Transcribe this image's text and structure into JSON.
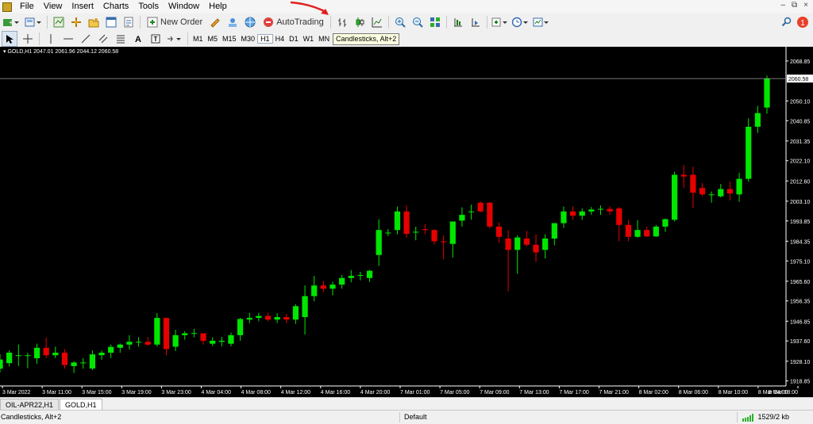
{
  "menu": [
    "File",
    "View",
    "Insert",
    "Charts",
    "Tools",
    "Window",
    "Help"
  ],
  "toolbar": {
    "new_order": "New Order",
    "auto_trading": "AutoTrading",
    "timeframes": [
      "M1",
      "M5",
      "M15",
      "M30",
      "H1",
      "H4",
      "D1",
      "W1",
      "MN"
    ],
    "active_timeframe": "H1",
    "notification_count": "1"
  },
  "tooltip": "Candlesticks, Alt+2",
  "chart": {
    "symbol": "GOLD,H1",
    "ohlc": "2047.01 2061.96 2044.12 2060.58",
    "current_price": "2060.58",
    "price_axis": [
      "2068.85",
      "2060.58",
      "2050.10",
      "2040.85",
      "2031.35",
      "2022.10",
      "2012.60",
      "2003.10",
      "1993.85",
      "1984.35",
      "1975.10",
      "1965.60",
      "1956.35",
      "1946.85",
      "1937.60",
      "1928.10",
      "1918.85"
    ],
    "time_axis": [
      "3 Mar 2022",
      "3 Mar 11:00",
      "3 Mar 15:00",
      "3 Mar 19:00",
      "3 Mar 23:00",
      "4 Mar 04:00",
      "4 Mar 08:00",
      "4 Mar 12:00",
      "4 Mar 16:00",
      "4 Mar 20:00",
      "7 Mar 01:00",
      "7 Mar 05:00",
      "7 Mar 09:00",
      "7 Mar 13:00",
      "7 Mar 17:00",
      "7 Mar 21:00",
      "8 Mar 02:00",
      "8 Mar 06:00",
      "8 Mar 10:00",
      "8 Mar 14:00",
      "8 Mar 18:00"
    ],
    "colors": {
      "bull": "#00e600",
      "bear": "#e60000",
      "background": "#000000",
      "text": "#ffffff"
    }
  },
  "chart_data": {
    "type": "candlestick",
    "ylim": [
      1916.5,
      2075.5
    ],
    "candles": [
      {
        "o": 1924.6,
        "h": 1931.4,
        "l": 1922.8,
        "c": 1928.9
      },
      {
        "o": 1927.2,
        "h": 1933.2,
        "l": 1925.6,
        "c": 1932.1
      },
      {
        "o": 1930.9,
        "h": 1935.9,
        "l": 1925.8,
        "c": 1930.9
      },
      {
        "o": 1930.9,
        "h": 1932.0,
        "l": 1924.8,
        "c": 1930.9
      },
      {
        "o": 1929.5,
        "h": 1936.3,
        "l": 1926.9,
        "c": 1934.4
      },
      {
        "o": 1934.4,
        "h": 1939.2,
        "l": 1929.6,
        "c": 1930.9
      },
      {
        "o": 1930.9,
        "h": 1934.9,
        "l": 1929.6,
        "c": 1932.1
      },
      {
        "o": 1932.1,
        "h": 1933.8,
        "l": 1924.6,
        "c": 1926.3
      },
      {
        "o": 1925.8,
        "h": 1928.1,
        "l": 1922.6,
        "c": 1927.5
      },
      {
        "o": 1927.5,
        "h": 1929.6,
        "l": 1924.6,
        "c": 1927.5
      },
      {
        "o": 1924.7,
        "h": 1933.2,
        "l": 1923.9,
        "c": 1931.3
      },
      {
        "o": 1930.9,
        "h": 1933.1,
        "l": 1928.8,
        "c": 1932.1
      },
      {
        "o": 1932.1,
        "h": 1935.9,
        "l": 1929.6,
        "c": 1934.8
      },
      {
        "o": 1934.4,
        "h": 1936.4,
        "l": 1932.1,
        "c": 1935.9
      },
      {
        "o": 1935.9,
        "h": 1940.3,
        "l": 1933.6,
        "c": 1937.2
      },
      {
        "o": 1937.2,
        "h": 1939.4,
        "l": 1934.9,
        "c": 1937.2
      },
      {
        "o": 1937.2,
        "h": 1939.4,
        "l": 1935.3,
        "c": 1935.9
      },
      {
        "o": 1935.9,
        "h": 1950.6,
        "l": 1934.9,
        "c": 1948.4
      },
      {
        "o": 1948.4,
        "h": 1948.5,
        "l": 1930.9,
        "c": 1933.8
      },
      {
        "o": 1934.9,
        "h": 1942.8,
        "l": 1932.9,
        "c": 1940.3
      },
      {
        "o": 1940.3,
        "h": 1942.2,
        "l": 1938.2,
        "c": 1941.2
      },
      {
        "o": 1941.3,
        "h": 1943.3,
        "l": 1939.3,
        "c": 1941.3
      },
      {
        "o": 1941.2,
        "h": 1941.2,
        "l": 1935.9,
        "c": 1937.7
      },
      {
        "o": 1936.3,
        "h": 1939.3,
        "l": 1935.2,
        "c": 1937.7
      },
      {
        "o": 1937.2,
        "h": 1939.5,
        "l": 1935.1,
        "c": 1937.7
      },
      {
        "o": 1936.3,
        "h": 1941.5,
        "l": 1935.1,
        "c": 1940.3
      },
      {
        "o": 1940.3,
        "h": 1948.4,
        "l": 1937.7,
        "c": 1947.9
      },
      {
        "o": 1947.6,
        "h": 1950.8,
        "l": 1945.9,
        "c": 1948.4
      },
      {
        "o": 1948.4,
        "h": 1950.8,
        "l": 1946.8,
        "c": 1949.3
      },
      {
        "o": 1949.3,
        "h": 1950.9,
        "l": 1946.8,
        "c": 1947.6
      },
      {
        "o": 1947.6,
        "h": 1950.6,
        "l": 1946.0,
        "c": 1948.8
      },
      {
        "o": 1948.8,
        "h": 1950.3,
        "l": 1946.0,
        "c": 1947.6
      },
      {
        "o": 1947.6,
        "h": 1954.8,
        "l": 1945.6,
        "c": 1953.9
      },
      {
        "o": 1948.8,
        "h": 1963.6,
        "l": 1940.6,
        "c": 1958.6
      },
      {
        "o": 1958.6,
        "h": 1968.1,
        "l": 1956.2,
        "c": 1963.6
      },
      {
        "o": 1963.6,
        "h": 1965.7,
        "l": 1960.5,
        "c": 1962.1
      },
      {
        "o": 1962.1,
        "h": 1965.3,
        "l": 1958.9,
        "c": 1964.0
      },
      {
        "o": 1964.0,
        "h": 1968.5,
        "l": 1962.1,
        "c": 1967.1
      },
      {
        "o": 1967.1,
        "h": 1970.8,
        "l": 1965.1,
        "c": 1968.1
      },
      {
        "o": 1968.1,
        "h": 1970.0,
        "l": 1966.0,
        "c": 1968.5
      },
      {
        "o": 1967.1,
        "h": 1970.9,
        "l": 1965.3,
        "c": 1970.5
      },
      {
        "o": 1977.9,
        "h": 1994.7,
        "l": 1972.8,
        "c": 1989.6
      },
      {
        "o": 1988.4,
        "h": 1990.0,
        "l": 1986.8,
        "c": 1988.4
      },
      {
        "o": 1989.6,
        "h": 2000.6,
        "l": 1987.6,
        "c": 1998.3
      },
      {
        "o": 1998.3,
        "h": 2001.1,
        "l": 1986.0,
        "c": 1987.8
      },
      {
        "o": 1988.4,
        "h": 1991.2,
        "l": 1984.8,
        "c": 1988.8
      },
      {
        "o": 1990.0,
        "h": 1992.4,
        "l": 1987.6,
        "c": 1989.6
      },
      {
        "o": 1989.6,
        "h": 1990.0,
        "l": 1982.8,
        "c": 1984.3
      },
      {
        "o": 1984.3,
        "h": 1987.1,
        "l": 1975.9,
        "c": 1983.9
      },
      {
        "o": 1983.1,
        "h": 1993.2,
        "l": 1976.7,
        "c": 1993.6
      },
      {
        "o": 1994.0,
        "h": 2000.2,
        "l": 1991.2,
        "c": 1996.7
      },
      {
        "o": 1998.3,
        "h": 2001.5,
        "l": 1994.4,
        "c": 1998.3
      },
      {
        "o": 2002.4,
        "h": 2003.0,
        "l": 1997.9,
        "c": 1998.3
      },
      {
        "o": 2002.4,
        "h": 2002.8,
        "l": 1990.4,
        "c": 1991.2
      },
      {
        "o": 1991.2,
        "h": 1993.2,
        "l": 1983.6,
        "c": 1986.4
      },
      {
        "o": 1985.6,
        "h": 1989.6,
        "l": 1960.9,
        "c": 1980.3
      },
      {
        "o": 1980.3,
        "h": 1987.1,
        "l": 1969.1,
        "c": 1986.1
      },
      {
        "o": 1985.6,
        "h": 1989.2,
        "l": 1981.8,
        "c": 1982.7
      },
      {
        "o": 1982.7,
        "h": 1987.6,
        "l": 1974.6,
        "c": 1979.1
      },
      {
        "o": 1980.3,
        "h": 1987.6,
        "l": 1976.3,
        "c": 1985.6
      },
      {
        "o": 1985.6,
        "h": 1992.8,
        "l": 1982.4,
        "c": 1992.8
      },
      {
        "o": 1992.8,
        "h": 2000.6,
        "l": 1990.6,
        "c": 1998.3
      },
      {
        "o": 1998.3,
        "h": 2000.7,
        "l": 1994.4,
        "c": 1996.3
      },
      {
        "o": 1996.3,
        "h": 1999.8,
        "l": 1994.4,
        "c": 1998.3
      },
      {
        "o": 1998.3,
        "h": 2000.4,
        "l": 1996.7,
        "c": 1999.2
      },
      {
        "o": 1999.2,
        "h": 2001.1,
        "l": 1996.7,
        "c": 1999.5
      },
      {
        "o": 1999.5,
        "h": 2000.7,
        "l": 1996.7,
        "c": 1998.3
      },
      {
        "o": 1999.7,
        "h": 2000.4,
        "l": 1984.3,
        "c": 1992.0
      },
      {
        "o": 1992.0,
        "h": 1994.4,
        "l": 1984.3,
        "c": 1986.4
      },
      {
        "o": 1986.4,
        "h": 1994.2,
        "l": 1986.0,
        "c": 1989.6
      },
      {
        "o": 1989.6,
        "h": 1991.2,
        "l": 1986.4,
        "c": 1986.6
      },
      {
        "o": 1986.6,
        "h": 1992.0,
        "l": 1986.4,
        "c": 1991.2
      },
      {
        "o": 1991.2,
        "h": 1995.0,
        "l": 1988.8,
        "c": 1994.7
      },
      {
        "o": 1994.4,
        "h": 2016.9,
        "l": 1993.6,
        "c": 2015.5
      },
      {
        "o": 2015.5,
        "h": 2020.1,
        "l": 2009.3,
        "c": 2014.7
      },
      {
        "o": 2015.5,
        "h": 2019.3,
        "l": 1999.9,
        "c": 2007.1
      },
      {
        "o": 2009.3,
        "h": 2011.6,
        "l": 2005.4,
        "c": 2006.3
      },
      {
        "o": 2006.3,
        "h": 2007.7,
        "l": 2002.4,
        "c": 2006.3
      },
      {
        "o": 2005.4,
        "h": 2011.2,
        "l": 2004.9,
        "c": 2008.8
      },
      {
        "o": 2008.8,
        "h": 2012.3,
        "l": 2003.5,
        "c": 2006.7
      },
      {
        "o": 2006.3,
        "h": 2016.4,
        "l": 2002.8,
        "c": 2013.6
      },
      {
        "o": 2013.6,
        "h": 2042.0,
        "l": 2012.2,
        "c": 2038.0
      },
      {
        "o": 2038.0,
        "h": 2047.8,
        "l": 2035.1,
        "c": 2044.4
      },
      {
        "o": 2047.0,
        "h": 2062.0,
        "l": 2044.1,
        "c": 2060.6
      }
    ]
  },
  "tabs": [
    "OIL-APR22,H1",
    "GOLD,H1"
  ],
  "active_tab": "GOLD,H1",
  "status": {
    "hint": "Candlesticks, Alt+2",
    "profile": "Default",
    "traffic": "1529/2 kb"
  }
}
